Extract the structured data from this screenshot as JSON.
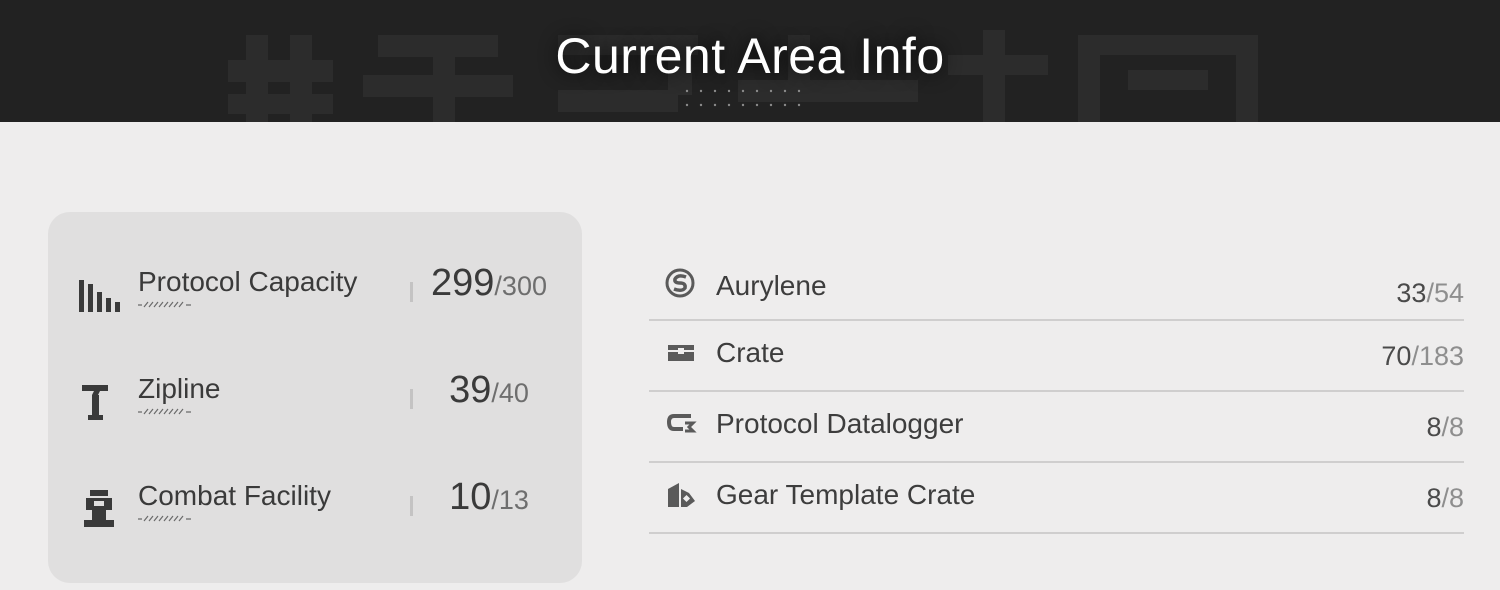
{
  "header": {
    "title": "Current Area Info"
  },
  "capacity": {
    "items": [
      {
        "icon": "bar-graph-icon",
        "label": "Protocol Capacity",
        "current": "299",
        "max": "/300"
      },
      {
        "icon": "zipline-icon",
        "label": "Zipline",
        "current": "39",
        "max": "/40"
      },
      {
        "icon": "combat-facility-icon",
        "label": "Combat Facility",
        "current": "10",
        "max": "/13"
      }
    ]
  },
  "resources": {
    "items": [
      {
        "icon": "aurylene-icon",
        "label": "Aurylene",
        "current": "33",
        "max": "/54"
      },
      {
        "icon": "crate-icon",
        "label": "Crate",
        "current": "70",
        "max": "/183"
      },
      {
        "icon": "datalogger-icon",
        "label": "Protocol Datalogger",
        "current": "8",
        "max": "/8"
      },
      {
        "icon": "gear-template-crate-icon",
        "label": "Gear Template Crate",
        "current": "8",
        "max": "/8"
      }
    ]
  },
  "colors": {
    "header_bg": "#222222",
    "page_bg": "#eeeded",
    "panel_bg": "#e0dfdf",
    "text_dark": "#3a3a3a",
    "text_muted": "#8e8e8e"
  }
}
